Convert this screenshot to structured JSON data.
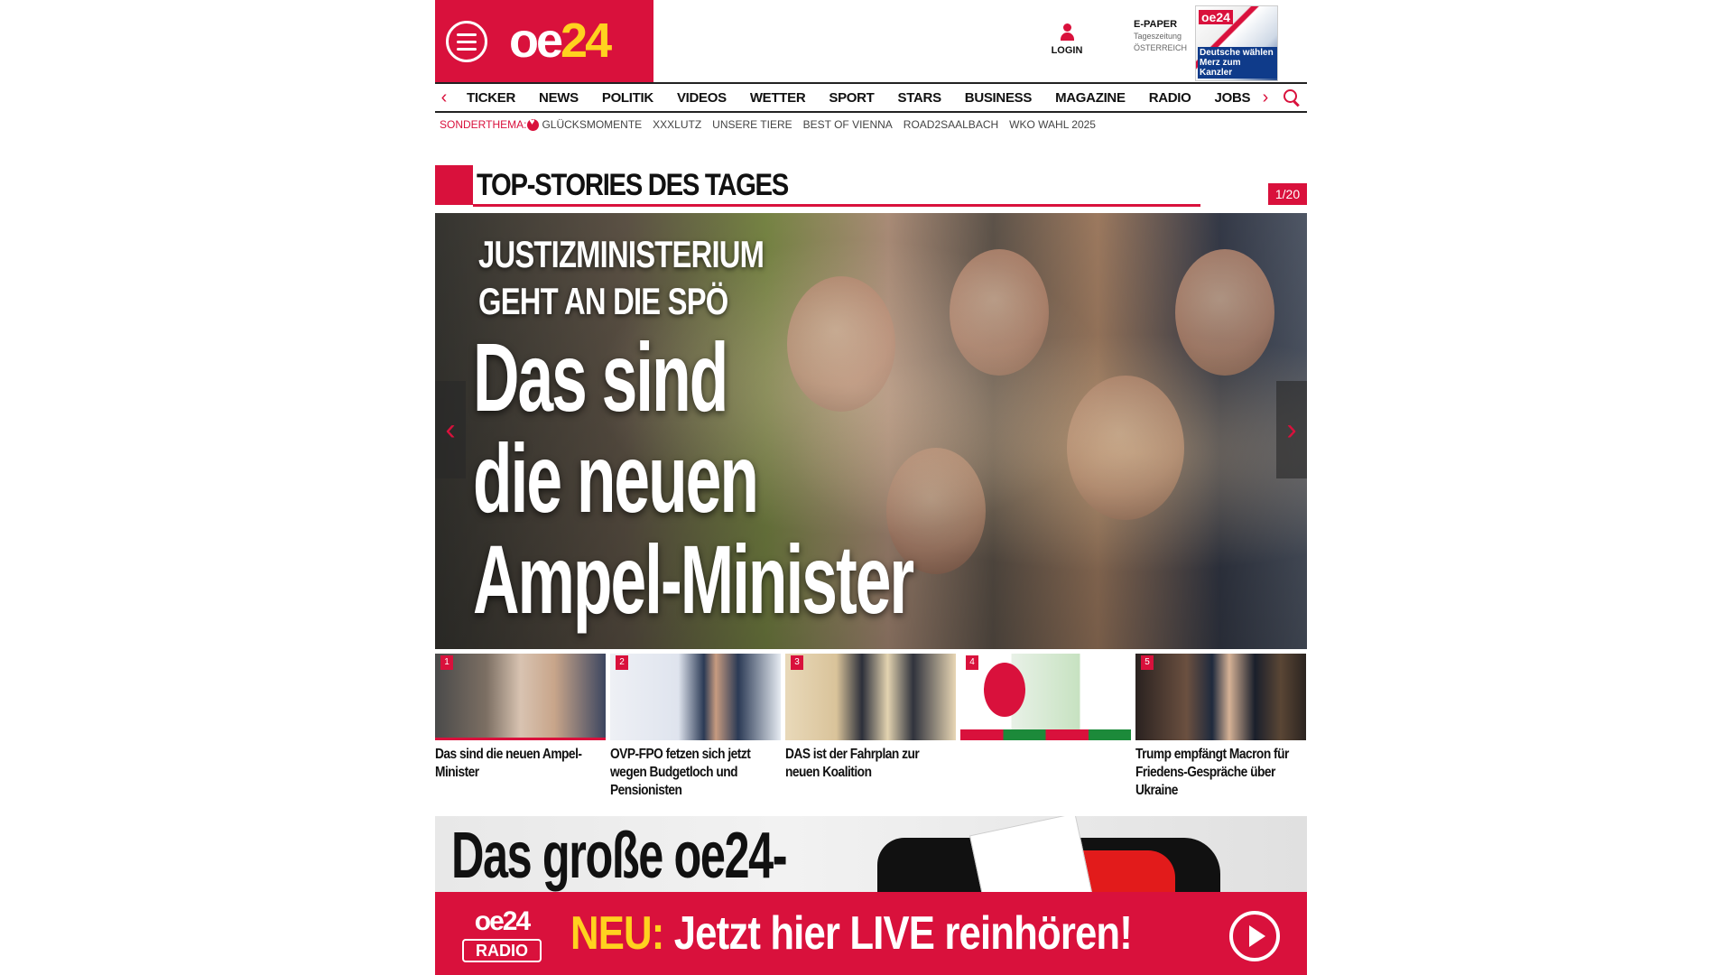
{
  "brand": {
    "logo_oe": "oe",
    "logo_num": "24"
  },
  "header": {
    "login_label": "LOGIN",
    "epaper_title": "E-PAPER",
    "epaper_sub1": "Tageszeitung",
    "epaper_sub2": "ÖSTERREICH",
    "epaper_cover_logo": "oe24",
    "epaper_cover_headline": "Deutsche wählen Merz zum Kanzler"
  },
  "nav": {
    "items": [
      "TICKER",
      "NEWS",
      "POLITIK",
      "VIDEOS",
      "WETTER",
      "SPORT",
      "STARS",
      "BUSINESS",
      "MAGAZINE",
      "RADIO",
      "JOBS"
    ],
    "prev_arrow": "‹",
    "next_arrow": "›"
  },
  "subnav": {
    "label": "SONDERTHEMA:",
    "items": [
      "GLÜCKSMOMENTE",
      "XXXLUTZ",
      "UNSERE TIERE",
      "BEST OF VIENNA",
      "ROAD2SAALBACH",
      "WKO WAHL 2025"
    ]
  },
  "section": {
    "title": "TOP-STORIES DES TAGES",
    "counter": "1/20"
  },
  "hero": {
    "kicker_line1": "JUSTIZMINISTERIUM",
    "kicker_line2": "GEHT AN DIE SPÖ",
    "headline_line1": "Das sind",
    "headline_line2": "die neuen",
    "headline_line3": "Ampel-Minister",
    "prev": "‹",
    "next": "›"
  },
  "thumbnails": [
    {
      "num": "1",
      "title": "Das sind die neuen Ampel-Minister",
      "active": true
    },
    {
      "num": "2",
      "title": "OVP-FPO fetzen sich jetzt wegen Budgetloch und Pensionisten",
      "active": false
    },
    {
      "num": "3",
      "title": "DAS ist der Fahrplan zur neuen Koalition",
      "active": false
    },
    {
      "num": "4",
      "title": "",
      "active": false
    },
    {
      "num": "5",
      "title": "Trump empfängt Macron für Friedens-Gespräche über Ukraine",
      "active": false
    }
  ],
  "promo": {
    "title": "Das große oe24-"
  },
  "radio": {
    "logo_text": "oe24",
    "logo_sub": "RADIO",
    "neu": "NEU:",
    "text": " Jetzt hier LIVE reinhören!"
  },
  "colors": {
    "brand_red": "#d9113c",
    "accent_yellow": "#ffd21f"
  }
}
